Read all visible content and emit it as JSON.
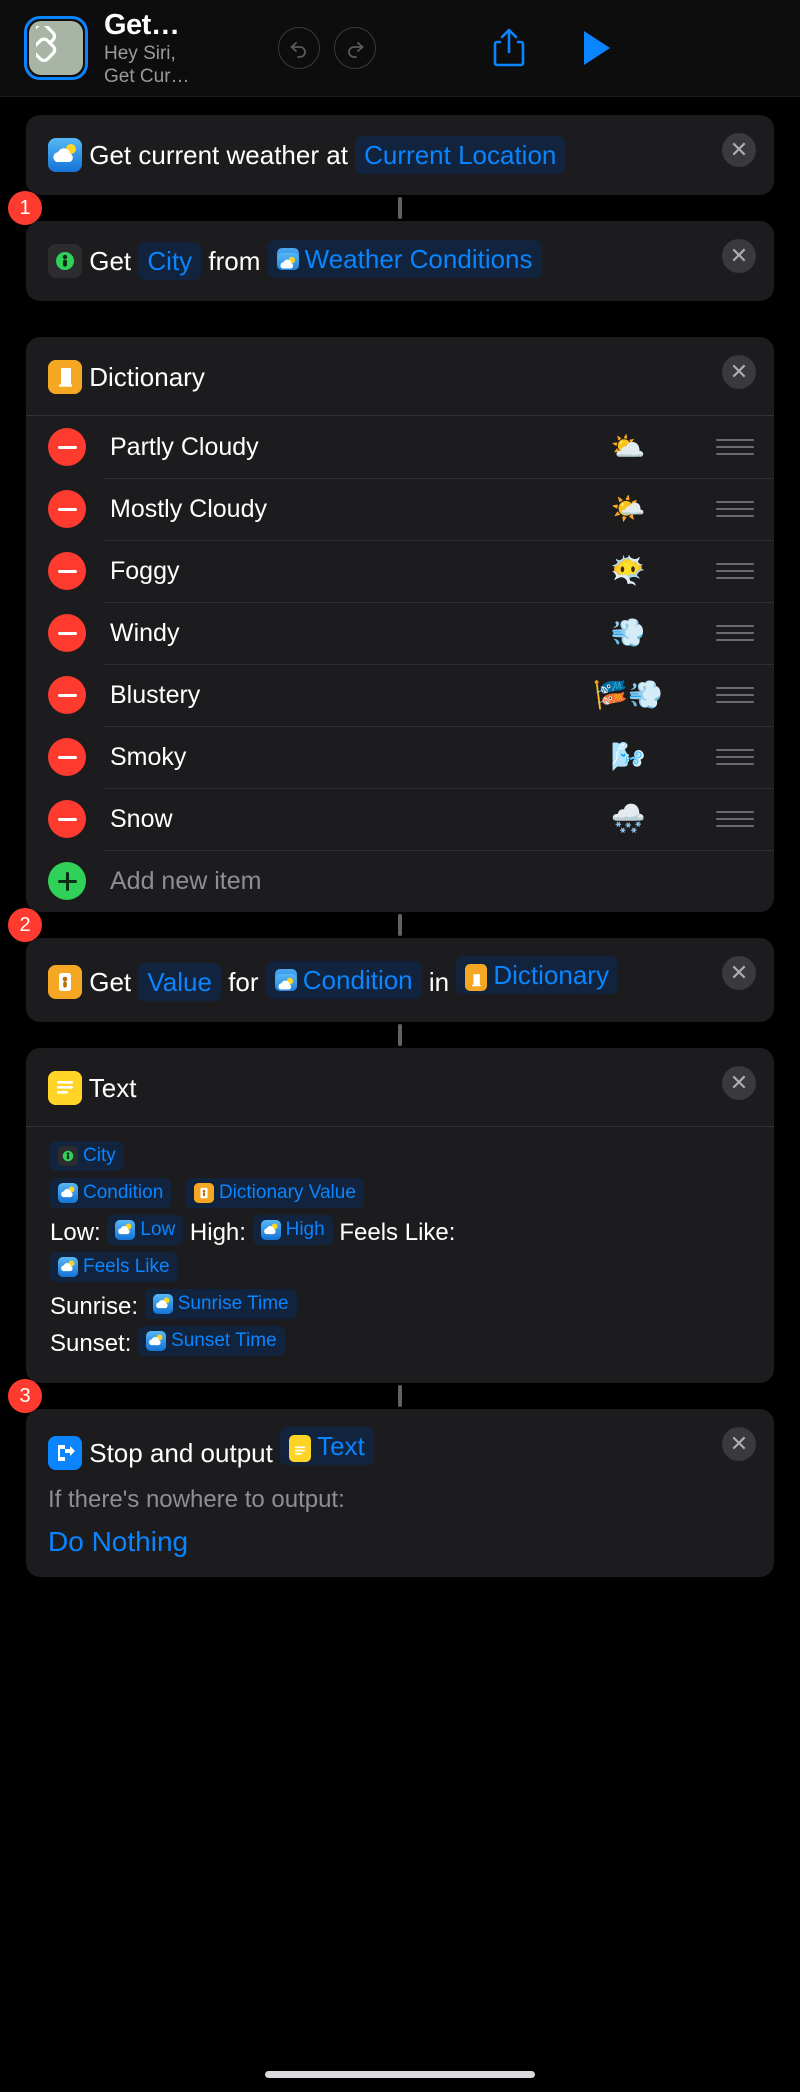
{
  "header": {
    "title": "Get…",
    "subtitle_line1": "Hey Siri,",
    "subtitle_line2": "Get Cur…",
    "app_icon_name": "shortcuts-app-icon",
    "undo_label": "Undo",
    "redo_label": "Redo",
    "share_label": "Share",
    "play_label": "Play",
    "accent": "#0a84ff"
  },
  "steps": {
    "badge1": "1",
    "badge2": "2",
    "badge3": "3"
  },
  "actions": {
    "weather": {
      "text_before": "Get current weather at",
      "token_location": "Current Location",
      "icon": "weather-app-icon"
    },
    "get_city": {
      "word_get": "Get",
      "token_property": "City",
      "word_from": "from",
      "token_source": "Weather Conditions",
      "icon": "get-details-icon"
    },
    "dictionary": {
      "title": "Dictionary",
      "icon": "dictionary-icon",
      "add_label": "Add new item",
      "items": [
        {
          "key": "Partly Cloudy",
          "value": "⛅"
        },
        {
          "key": "Mostly Cloudy",
          "value": "🌤️"
        },
        {
          "key": "Foggy",
          "value": "😶‍🌫️"
        },
        {
          "key": "Windy",
          "value": "💨"
        },
        {
          "key": "Blustery",
          "value": "🎏💨"
        },
        {
          "key": "Smoky",
          "value": "🌬️"
        },
        {
          "key": "Snow",
          "value": "🌨️"
        }
      ]
    },
    "get_value": {
      "word_get": "Get",
      "token_value": "Value",
      "word_for": "for",
      "token_condition": "Condition",
      "word_in": "in",
      "token_dictionary": "Dictionary",
      "icon": "dictionary-get-icon"
    },
    "text": {
      "title": "Text",
      "icon": "text-icon",
      "tokens": {
        "city": "City",
        "condition": "Condition",
        "dictionary_value": "Dictionary Value",
        "low": "Low",
        "high": "High",
        "feels_like": "Feels Like",
        "sunrise_time": "Sunrise Time",
        "sunset_time": "Sunset Time"
      },
      "labels": {
        "low": "Low:",
        "high": "High:",
        "feels_like": "Feels Like:",
        "sunrise": "Sunrise:",
        "sunset": "Sunset:"
      }
    },
    "stop": {
      "text_before": "Stop and output",
      "token_text": "Text",
      "fallback_label": "If there's nowhere to output:",
      "fallback_value": "Do Nothing",
      "icon": "stop-output-icon"
    }
  },
  "icons": {
    "close": "✕"
  }
}
